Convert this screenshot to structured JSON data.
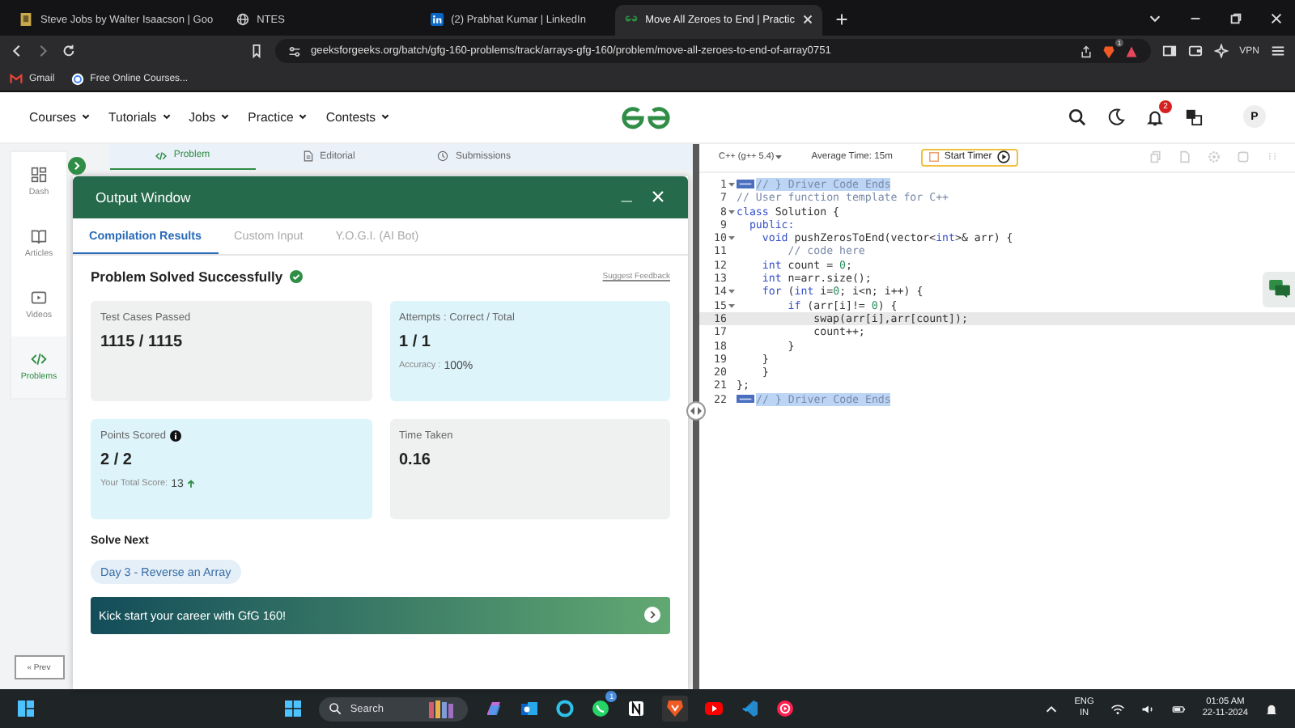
{
  "browser": {
    "tabs": [
      {
        "title": "Steve Jobs by Walter Isaacson | Goo",
        "selected": false
      },
      {
        "title": "NTES",
        "selected": false
      },
      {
        "title": "(2) Prabhat Kumar | LinkedIn",
        "selected": false
      },
      {
        "title": "Move All Zeroes to End | Practic",
        "selected": true
      }
    ],
    "address": "geeksforgeeks.org/batch/gfg-160-problems/track/arrays-gfg-160/problem/move-all-zeroes-to-end-of-array0751",
    "shield_badge": "1",
    "vpn": "VPN",
    "bookmarks": [
      {
        "label": "Gmail"
      },
      {
        "label": "Free Online Courses..."
      }
    ]
  },
  "site_header": {
    "nav": [
      "Courses",
      "Tutorials",
      "Jobs",
      "Practice",
      "Contests"
    ],
    "notification_count": "2",
    "avatar": "P"
  },
  "sidebar": {
    "items": [
      {
        "label": "Dash",
        "selected": false
      },
      {
        "label": "Articles",
        "selected": false
      },
      {
        "label": "Videos",
        "selected": false
      },
      {
        "label": "Problems",
        "selected": true
      }
    ],
    "prev_button": "« Prev"
  },
  "problem_tabs": [
    {
      "label": "Problem",
      "selected": true
    },
    {
      "label": "Editorial",
      "selected": false
    },
    {
      "label": "Submissions",
      "selected": false
    }
  ],
  "output_window": {
    "title": "Output Window",
    "tabs": [
      {
        "label": "Compilation Results",
        "selected": true
      },
      {
        "label": "Custom Input",
        "selected": false
      },
      {
        "label": "Y.O.G.I. (AI Bot)",
        "selected": false
      }
    ],
    "status": "Problem Solved Successfully",
    "feedback_link": "Suggest Feedback",
    "cards": [
      {
        "label": "Test Cases Passed",
        "value": "1115 / 1115",
        "highlighted": false,
        "info": false
      },
      {
        "label": "Attempts : Correct / Total",
        "value": "1 / 1",
        "highlighted": true,
        "info": false,
        "note_label": "Accuracy :",
        "note_value": "100%",
        "trend_up": false
      },
      {
        "label": "Points Scored",
        "value": "2 / 2",
        "highlighted": true,
        "info": true,
        "note_label": "Your Total Score:",
        "note_value": "13",
        "trend_up": true
      },
      {
        "label": "Time Taken",
        "value": "0.16",
        "highlighted": false,
        "info": false
      }
    ],
    "solve_next_heading": "Solve Next",
    "next_problem": "Day 3 - Reverse an Array",
    "banner": "Kick start your career with GfG 160!"
  },
  "editor": {
    "language": "C++ (g++ 5.4)",
    "average_time": "Average Time: 15m",
    "timer_button": "Start Timer",
    "lines": [
      {
        "number": "1",
        "foldable": true,
        "selected": true,
        "current": false,
        "marker": true,
        "segments": [
          {
            "t": "// } Driver Code Ends",
            "kind": "comment"
          }
        ]
      },
      {
        "number": "7",
        "foldable": false,
        "selected": false,
        "current": false,
        "marker": false,
        "segments": [
          {
            "t": "// User function template for C++",
            "kind": "comment"
          }
        ]
      },
      {
        "number": "8",
        "foldable": true,
        "selected": false,
        "current": false,
        "marker": false,
        "segments": [
          {
            "t": "class",
            "kind": "keyword"
          },
          {
            "t": " Solution {",
            "kind": "plain"
          }
        ]
      },
      {
        "number": "9",
        "foldable": false,
        "selected": false,
        "current": false,
        "marker": false,
        "segments": [
          {
            "t": "  public:",
            "kind": "keyword"
          }
        ]
      },
      {
        "number": "10",
        "foldable": true,
        "selected": false,
        "current": false,
        "marker": false,
        "segments": [
          {
            "t": "    void",
            "kind": "keyword"
          },
          {
            "t": " pushZerosToEnd(vector<",
            "kind": "plain"
          },
          {
            "t": "int",
            "kind": "keyword"
          },
          {
            "t": ">& arr) {",
            "kind": "plain"
          }
        ]
      },
      {
        "number": "11",
        "foldable": false,
        "selected": false,
        "current": false,
        "marker": false,
        "segments": [
          {
            "t": "        // code here",
            "kind": "comment"
          }
        ]
      },
      {
        "number": "12",
        "foldable": false,
        "selected": false,
        "current": false,
        "marker": false,
        "segments": [
          {
            "t": "    int",
            "kind": "keyword"
          },
          {
            "t": " count = ",
            "kind": "plain"
          },
          {
            "t": "0",
            "kind": "number"
          },
          {
            "t": ";",
            "kind": "plain"
          }
        ]
      },
      {
        "number": "13",
        "foldable": false,
        "selected": false,
        "current": false,
        "marker": false,
        "segments": [
          {
            "t": "    int",
            "kind": "keyword"
          },
          {
            "t": " n=arr.size();",
            "kind": "plain"
          }
        ]
      },
      {
        "number": "14",
        "foldable": true,
        "selected": false,
        "current": false,
        "marker": false,
        "segments": [
          {
            "t": "    for",
            "kind": "keyword"
          },
          {
            "t": " (",
            "kind": "plain"
          },
          {
            "t": "int",
            "kind": "keyword"
          },
          {
            "t": " i=",
            "kind": "plain"
          },
          {
            "t": "0",
            "kind": "number"
          },
          {
            "t": "; i<n; i++) {",
            "kind": "plain"
          }
        ]
      },
      {
        "number": "15",
        "foldable": true,
        "selected": false,
        "current": false,
        "marker": false,
        "segments": [
          {
            "t": "        if",
            "kind": "keyword"
          },
          {
            "t": " (arr[i]!= ",
            "kind": "plain"
          },
          {
            "t": "0",
            "kind": "number"
          },
          {
            "t": ") {",
            "kind": "plain"
          }
        ]
      },
      {
        "number": "16",
        "foldable": false,
        "selected": false,
        "current": true,
        "marker": false,
        "segments": [
          {
            "t": "            swap(arr[i],arr[count]);",
            "kind": "plain"
          }
        ]
      },
      {
        "number": "17",
        "foldable": false,
        "selected": false,
        "current": false,
        "marker": false,
        "segments": [
          {
            "t": "            count++;",
            "kind": "plain"
          }
        ]
      },
      {
        "number": "18",
        "foldable": false,
        "selected": false,
        "current": false,
        "marker": false,
        "segments": [
          {
            "t": "        }",
            "kind": "plain"
          }
        ]
      },
      {
        "number": "19",
        "foldable": false,
        "selected": false,
        "current": false,
        "marker": false,
        "segments": [
          {
            "t": "    }",
            "kind": "plain"
          }
        ]
      },
      {
        "number": "20",
        "foldable": false,
        "selected": false,
        "current": false,
        "marker": false,
        "segments": [
          {
            "t": "    }",
            "kind": "plain"
          }
        ]
      },
      {
        "number": "21",
        "foldable": false,
        "selected": false,
        "current": false,
        "marker": false,
        "segments": [
          {
            "t": "};",
            "kind": "plain"
          }
        ]
      },
      {
        "number": "22",
        "foldable": false,
        "selected": true,
        "current": false,
        "marker": true,
        "segments": [
          {
            "t": "// } Driver Code Ends",
            "kind": "comment"
          }
        ]
      }
    ]
  },
  "taskbar": {
    "search": "Search",
    "whatsapp_badge": "1",
    "language": "ENG",
    "region": "IN",
    "time": "01:05 AM",
    "date": "22-11-2024"
  }
}
